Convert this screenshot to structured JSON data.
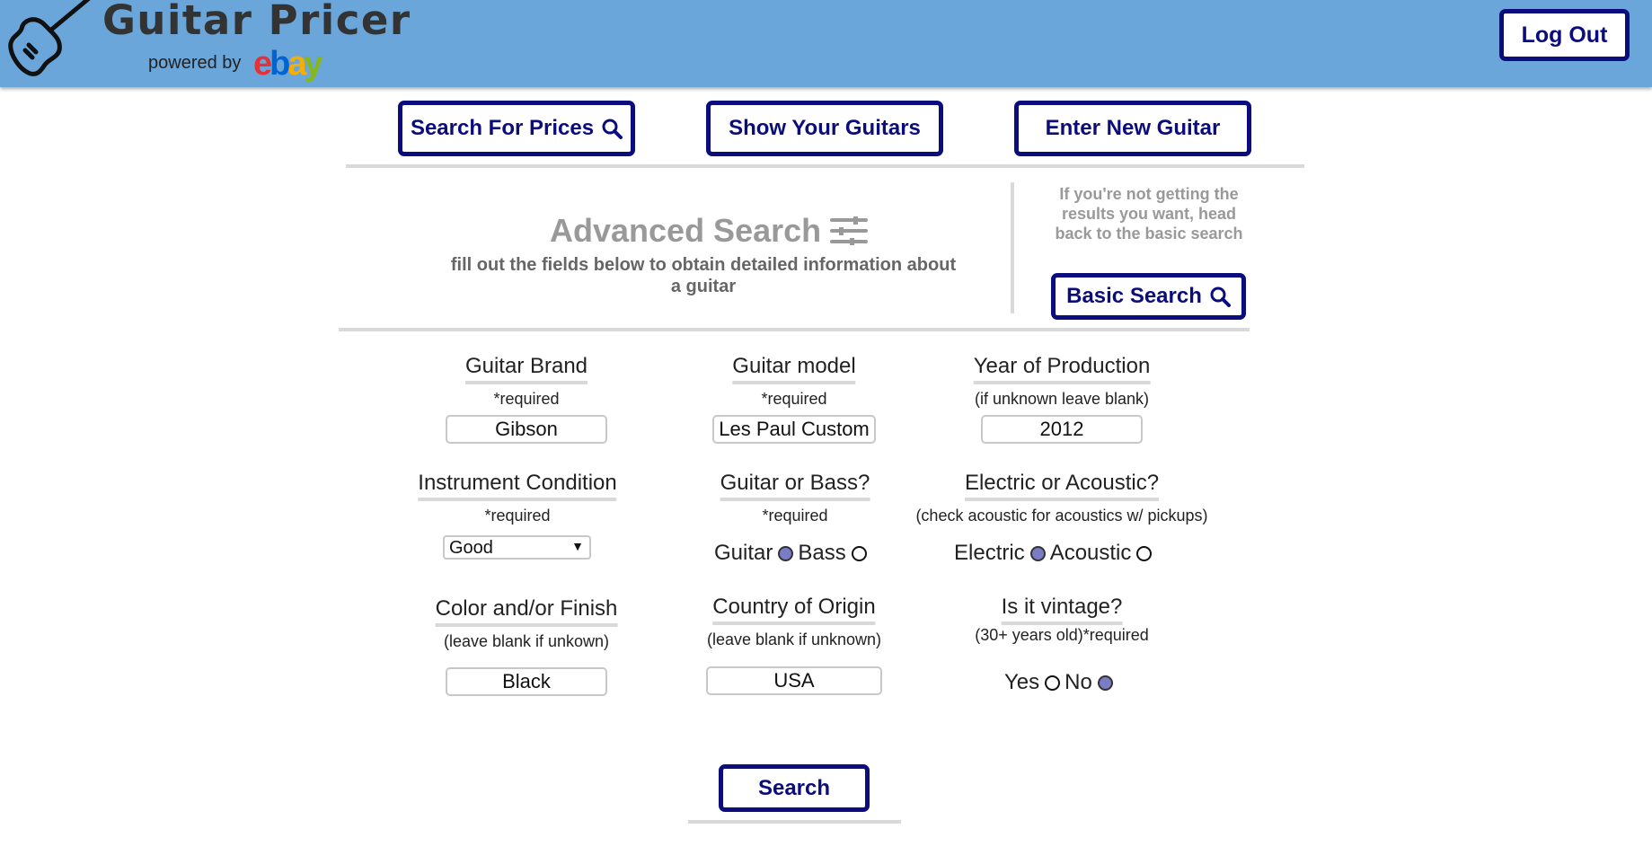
{
  "header": {
    "logo_icon": "guitar-icon",
    "app_title": "Guitar Pricer",
    "powered_by": "powered by",
    "ebay_logo": "ebay",
    "logout_label": "Log Out"
  },
  "nav": {
    "search_prices_label": "Search For Prices",
    "show_guitars_label": "Show Your Guitars",
    "enter_new_label": "Enter New Guitar"
  },
  "advanced": {
    "title": "Advanced Search",
    "title_icon": "sliders-icon",
    "subtitle": "fill out the fields below to obtain detailed information about a guitar",
    "hint": "If you're not getting the results you want, head back to the basic search",
    "basic_search_label": "Basic Search"
  },
  "form": {
    "brand": {
      "label": "Guitar Brand",
      "note": "*required",
      "value": "Gibson"
    },
    "model": {
      "label": "Guitar model",
      "note": "*required",
      "value": "Les Paul Custom"
    },
    "year": {
      "label": "Year of Production",
      "note": "(if unknown leave blank)",
      "value": "2012"
    },
    "condition": {
      "label": "Instrument Condition",
      "note": "*required",
      "selected": "Good"
    },
    "type": {
      "label": "Guitar or Bass?",
      "note": "*required",
      "option_a": "Guitar",
      "option_b": "Bass",
      "selected": "Guitar"
    },
    "electric": {
      "label": "Electric or Acoustic?",
      "note": "(check acoustic for acoustics w/ pickups)",
      "option_a": "Electric",
      "option_b": "Acoustic",
      "selected": "Electric"
    },
    "color": {
      "label": "Color and/or Finish",
      "note": "(leave blank if unkown)",
      "value": "Black"
    },
    "origin": {
      "label": "Country of Origin",
      "note": "(leave blank if unknown)",
      "value": "USA"
    },
    "vintage": {
      "label": "Is it vintage?",
      "note": "(30+ years old)*required",
      "option_a": "Yes",
      "option_b": "No",
      "selected": "No"
    },
    "search_label": "Search"
  },
  "colors": {
    "header_bg": "#6aa6d9",
    "button_border": "#0b0d7c",
    "radio_checked": "#7a7cc4"
  }
}
